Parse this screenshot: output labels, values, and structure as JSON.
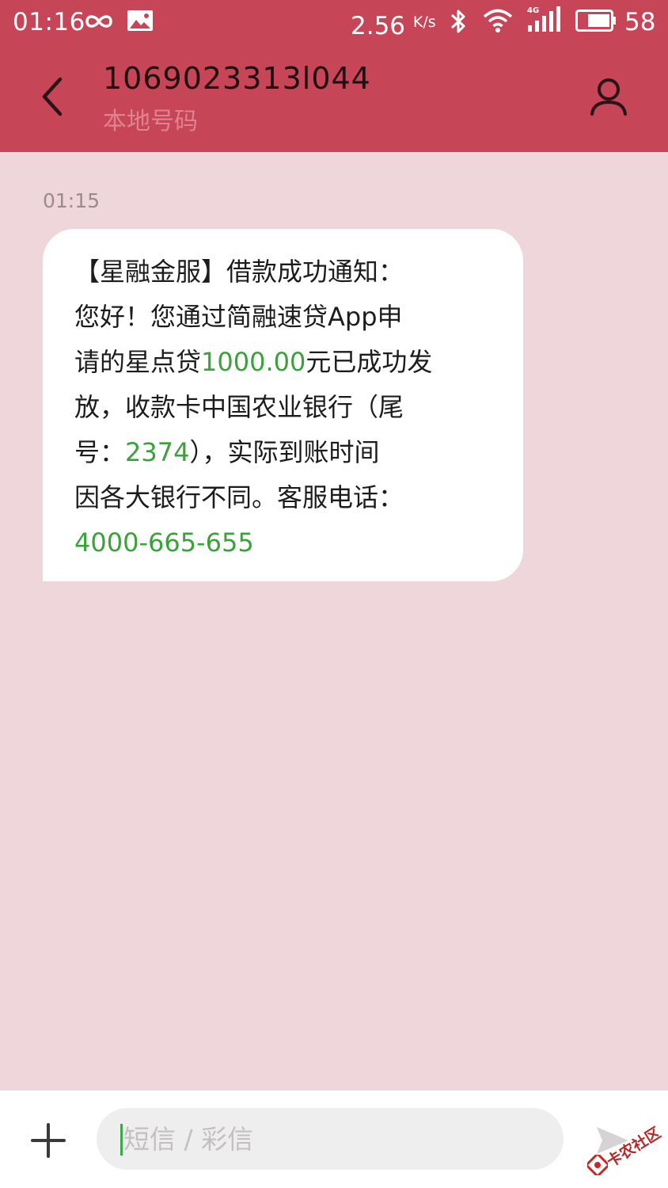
{
  "status_bar": {
    "time": "01:16",
    "net_speed": "2.56",
    "net_speed_unit": "K/s",
    "network_type": "4G",
    "battery": "58",
    "icons": [
      "infinity-icon",
      "photo-icon",
      "bluetooth-icon",
      "wifi-icon",
      "signal-icon",
      "battery-icon"
    ]
  },
  "header": {
    "contact_number": "1069023313l044",
    "contact_subtitle": "本地号码",
    "icons": [
      "back-arrow-icon",
      "person-icon"
    ]
  },
  "conversation": {
    "messages": [
      {
        "time": "01:15",
        "lines": [
          [
            {
              "text": "【星融金服】借款成功通知："
            }
          ],
          [
            {
              "text": "您好！您通过简融速贷App申"
            }
          ],
          [
            {
              "text": "请的星点贷"
            },
            {
              "text": "1000.00"
            },
            {
              "text": "元已成功发"
            }
          ],
          [
            {
              "text": "放，收款卡中国农业银行（尾"
            }
          ],
          [
            {
              "text": "号："
            },
            {
              "text": "2374"
            },
            {
              "text": "），实际到账时间"
            }
          ],
          [
            {
              "text": "因各大银行不同。客服电话："
            }
          ],
          [
            {
              "text": "4000-665-655"
            }
          ]
        ]
      }
    ]
  },
  "input_bar": {
    "placeholder": "短信 / 彩信",
    "value": "",
    "icons": [
      "plus-icon",
      "send-icon"
    ]
  },
  "watermark": {
    "text": "卡农社区"
  },
  "colors": {
    "header_bg": "#c64557",
    "conversation_bg": "#eed6da",
    "bubble_bg": "#ffffff",
    "highlight_text": "#3aa23a",
    "subtitle_text": "#e0838f",
    "caret": "#39a84a"
  }
}
